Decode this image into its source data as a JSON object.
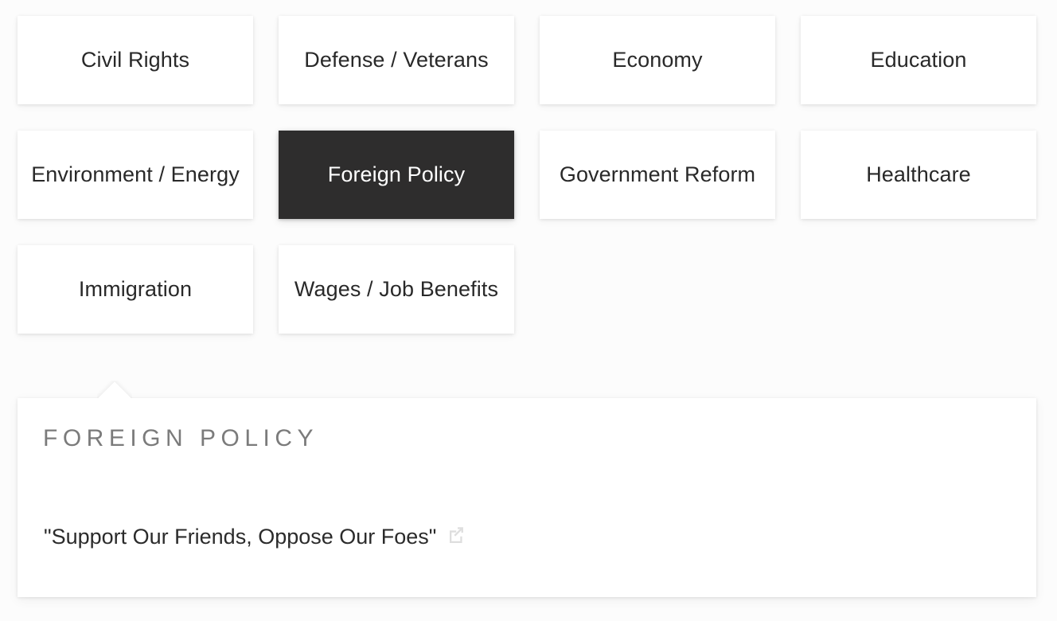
{
  "topics": [
    {
      "label": "Civil Rights",
      "selected": false
    },
    {
      "label": "Defense / Veterans",
      "selected": false
    },
    {
      "label": "Economy",
      "selected": false
    },
    {
      "label": "Education",
      "selected": false
    },
    {
      "label": "Environment / Energy",
      "selected": false
    },
    {
      "label": "Foreign Policy",
      "selected": true
    },
    {
      "label": "Government Reform",
      "selected": false
    },
    {
      "label": "Healthcare",
      "selected": false
    },
    {
      "label": "Immigration",
      "selected": false
    },
    {
      "label": "Wages / Job Benefits",
      "selected": false
    }
  ],
  "detail_panel": {
    "title": "FOREIGN POLICY",
    "quote": "\"Support Our Friends, Oppose Our Foes\"",
    "external_link_icon": "external-link-icon"
  },
  "colors": {
    "page_background": "#fcfcfc",
    "card_background": "#ffffff",
    "card_text": "#292929",
    "selected_card_background": "#2e2d2d",
    "selected_card_text": "#ffffff",
    "panel_title_text": "#7b7b7b",
    "quote_text": "#2b2b2b",
    "external_link_icon": "#dedede"
  }
}
